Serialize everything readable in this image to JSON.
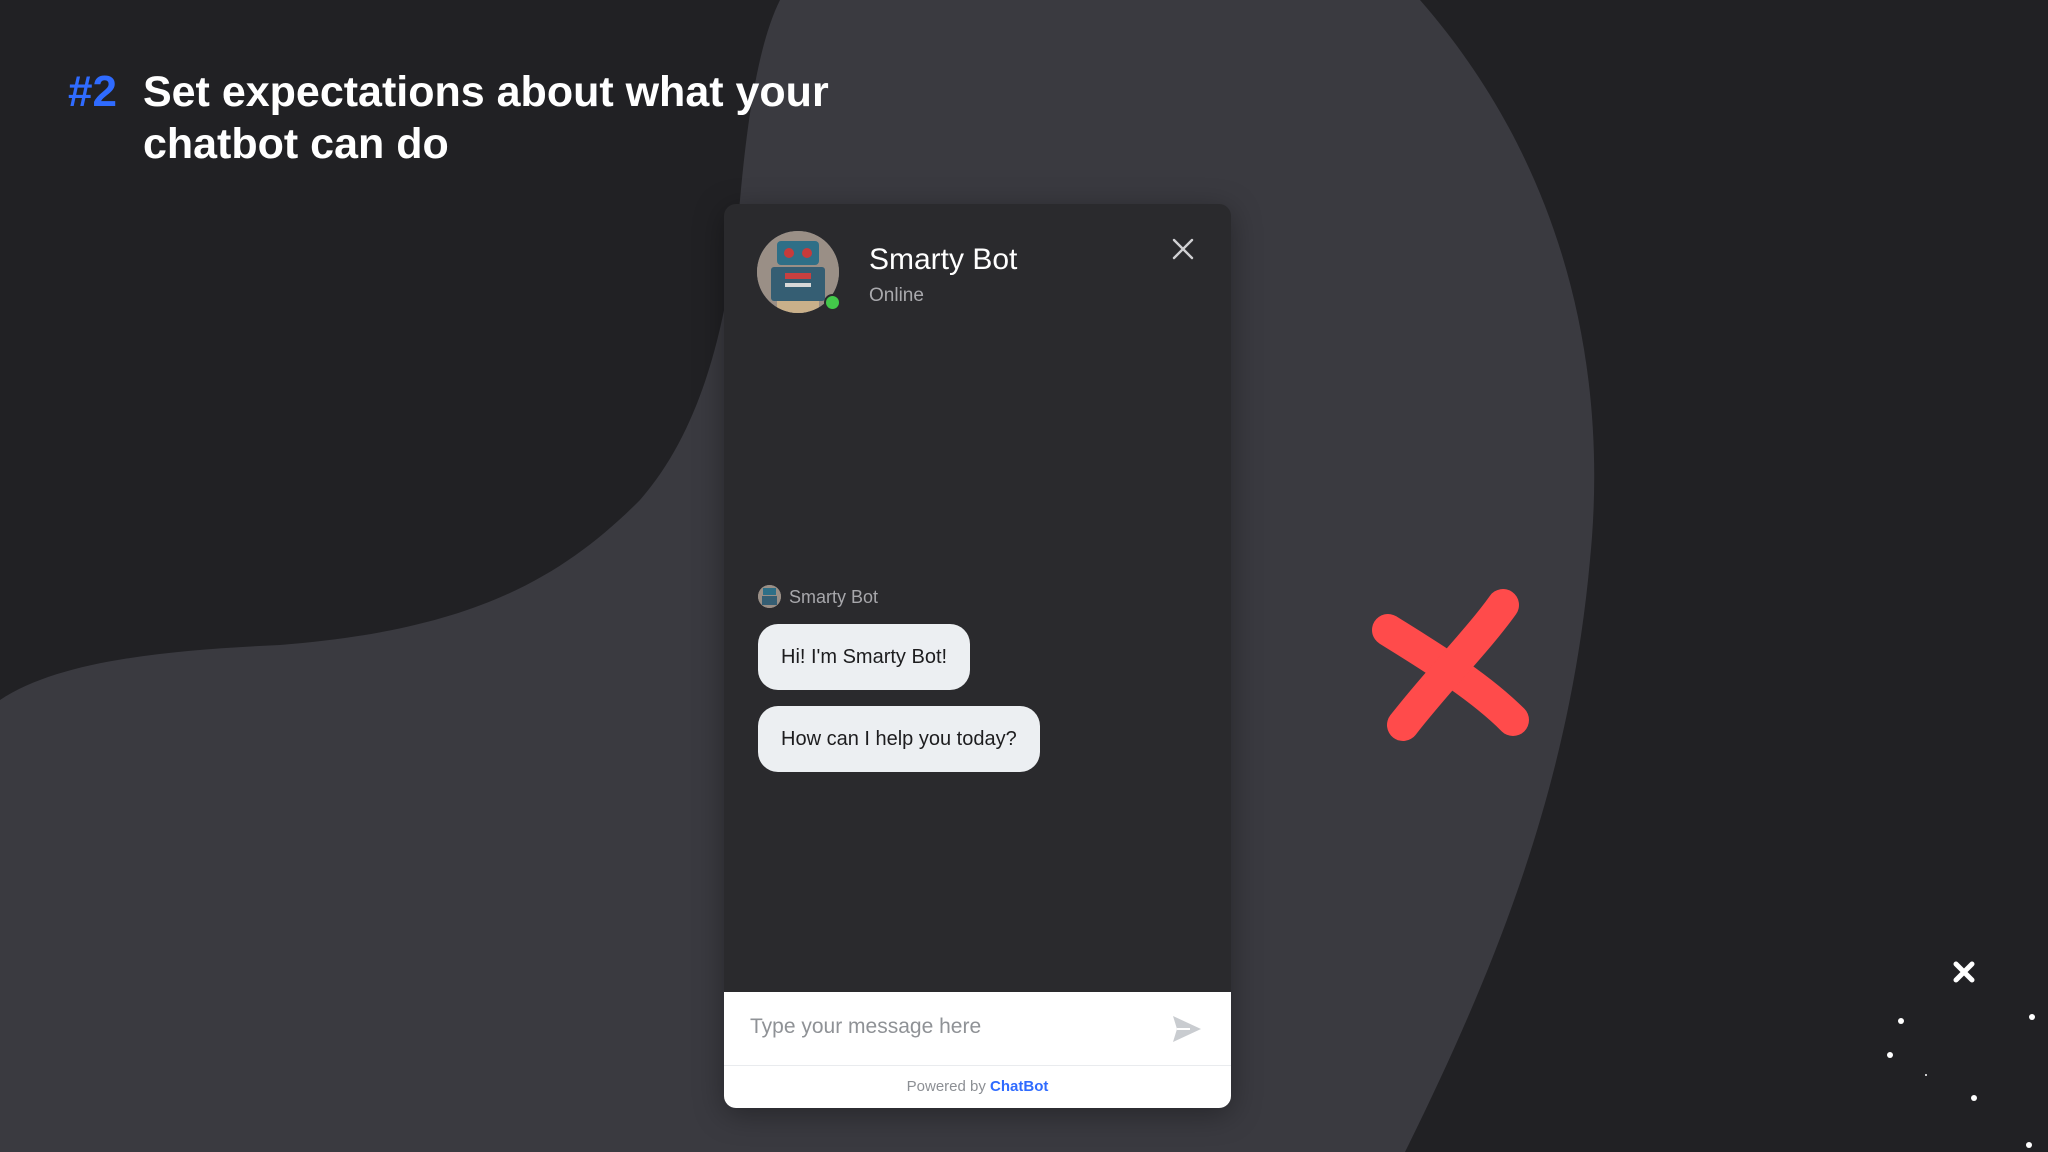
{
  "headline": {
    "number": "#2",
    "text": "Set expectations about what your chatbot can do"
  },
  "chat_widget": {
    "bot_name": "Smarty Bot",
    "status": "Online",
    "sender_label": "Smarty Bot",
    "messages": [
      "Hi! I'm Smarty Bot!",
      "How can I help you today?"
    ],
    "input": {
      "placeholder": "Type your message here",
      "value": ""
    },
    "footer": {
      "powered_by": "Powered by",
      "brand": "ChatBot"
    }
  },
  "icons": {
    "close": "close-icon",
    "send": "send-icon",
    "cross_mark": "red-cross-icon"
  },
  "colors": {
    "background": "#212124",
    "blob": "#3a3a40",
    "accent_blue": "#2f6bff",
    "cross_red": "#ff4b4b",
    "online_green": "#43c84a"
  }
}
